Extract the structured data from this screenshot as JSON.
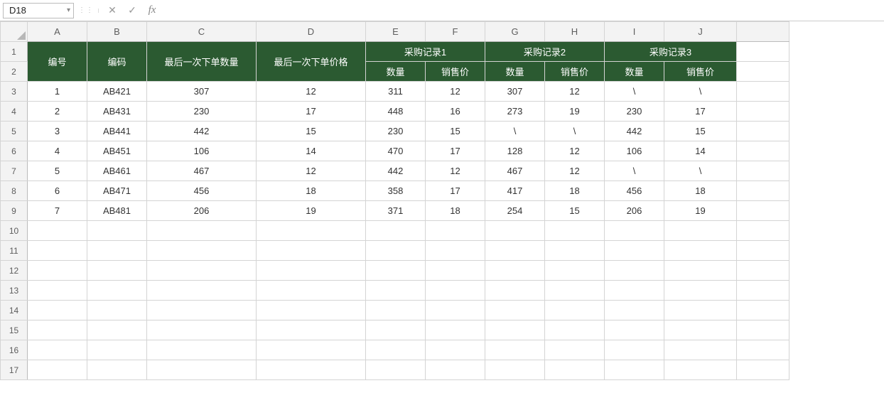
{
  "nameBox": "D18",
  "formula": "",
  "columnLabels": [
    "A",
    "B",
    "C",
    "D",
    "E",
    "F",
    "G",
    "H",
    "I",
    "J"
  ],
  "rowLabels": [
    1,
    2,
    3,
    4,
    5,
    6,
    7,
    8,
    9,
    10,
    11,
    12,
    13,
    14,
    15,
    16,
    17
  ],
  "headers": {
    "serial": "编号",
    "code": "编码",
    "lastQty": "最后一次下单数量",
    "lastPrice": "最后一次下单价格",
    "record1": "采购记录1",
    "record2": "采购记录2",
    "record3": "采购记录3",
    "qty": "数量",
    "price": "销售价"
  },
  "rows": [
    {
      "serial": "1",
      "code": "AB421",
      "lastQty": "307",
      "lastPrice": "12",
      "r1q": "311",
      "r1p": "12",
      "r2q": "307",
      "r2p": "12",
      "r3q": "\\",
      "r3p": "\\"
    },
    {
      "serial": "2",
      "code": "AB431",
      "lastQty": "230",
      "lastPrice": "17",
      "r1q": "448",
      "r1p": "16",
      "r2q": "273",
      "r2p": "19",
      "r3q": "230",
      "r3p": "17"
    },
    {
      "serial": "3",
      "code": "AB441",
      "lastQty": "442",
      "lastPrice": "15",
      "r1q": "230",
      "r1p": "15",
      "r2q": "\\",
      "r2p": "\\",
      "r3q": "442",
      "r3p": "15"
    },
    {
      "serial": "4",
      "code": "AB451",
      "lastQty": "106",
      "lastPrice": "14",
      "r1q": "470",
      "r1p": "17",
      "r2q": "128",
      "r2p": "12",
      "r3q": "106",
      "r3p": "14"
    },
    {
      "serial": "5",
      "code": "AB461",
      "lastQty": "467",
      "lastPrice": "12",
      "r1q": "442",
      "r1p": "12",
      "r2q": "467",
      "r2p": "12",
      "r3q": "\\",
      "r3p": "\\"
    },
    {
      "serial": "6",
      "code": "AB471",
      "lastQty": "456",
      "lastPrice": "18",
      "r1q": "358",
      "r1p": "17",
      "r2q": "417",
      "r2p": "18",
      "r3q": "456",
      "r3p": "18"
    },
    {
      "serial": "7",
      "code": "AB481",
      "lastQty": "206",
      "lastPrice": "19",
      "r1q": "371",
      "r1p": "18",
      "r2q": "254",
      "r2p": "15",
      "r3q": "206",
      "r3p": "19"
    }
  ],
  "colors": {
    "headerBg": "#2b5a31",
    "border": "#000000"
  }
}
